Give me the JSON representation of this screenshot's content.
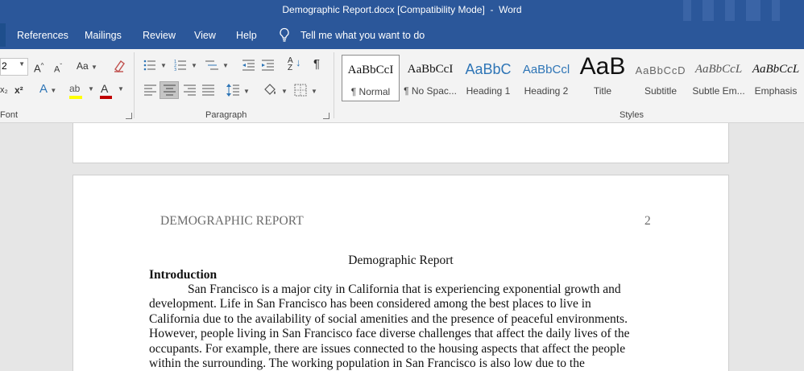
{
  "window": {
    "title": "Demographic Report.docx [Compatibility Mode]  -  Word"
  },
  "menu": {
    "tabs": [
      "References",
      "Mailings",
      "Review",
      "View",
      "Help"
    ],
    "tell_me": "Tell me what you want to do"
  },
  "font_group": {
    "size_value": "2",
    "change_case_label": "Aa",
    "label": "Font",
    "font_color": "#c00000",
    "highlight_color": "#ffff00"
  },
  "paragraph_group": {
    "label": "Paragraph"
  },
  "styles_group": {
    "label": "Styles",
    "items": [
      {
        "sample": "AaBbCcI",
        "name": "¶ Normal"
      },
      {
        "sample": "AaBbCcI",
        "name": "¶ No Spac..."
      },
      {
        "sample": "AaBbC",
        "name": "Heading 1"
      },
      {
        "sample": "AaBbCcl",
        "name": "Heading 2"
      },
      {
        "sample": "AaB",
        "name": "Title"
      },
      {
        "sample": "AaBbCcD",
        "name": "Subtitle"
      },
      {
        "sample": "AaBbCcL",
        "name": "Subtle Em..."
      },
      {
        "sample": "AaBbCcL",
        "name": "Emphasis"
      }
    ]
  },
  "document": {
    "running_head": "DEMOGRAPHIC REPORT",
    "page_number": "2",
    "title": "Demographic Report",
    "heading": "Introduction",
    "lines": [
      "San Francisco is a major city in California that is experiencing exponential growth and",
      "development. Life in San Francisco has been considered among the best places to live in",
      "California due to the availability of social amenities and the presence of peaceful environments.",
      "However, people living in San Francisco face diverse challenges that affect the daily lives of the",
      "occupants. For example, there are issues connected to the housing aspects that affect the people",
      "within the surrounding. The working population in San Francisco is also low due to the"
    ]
  }
}
